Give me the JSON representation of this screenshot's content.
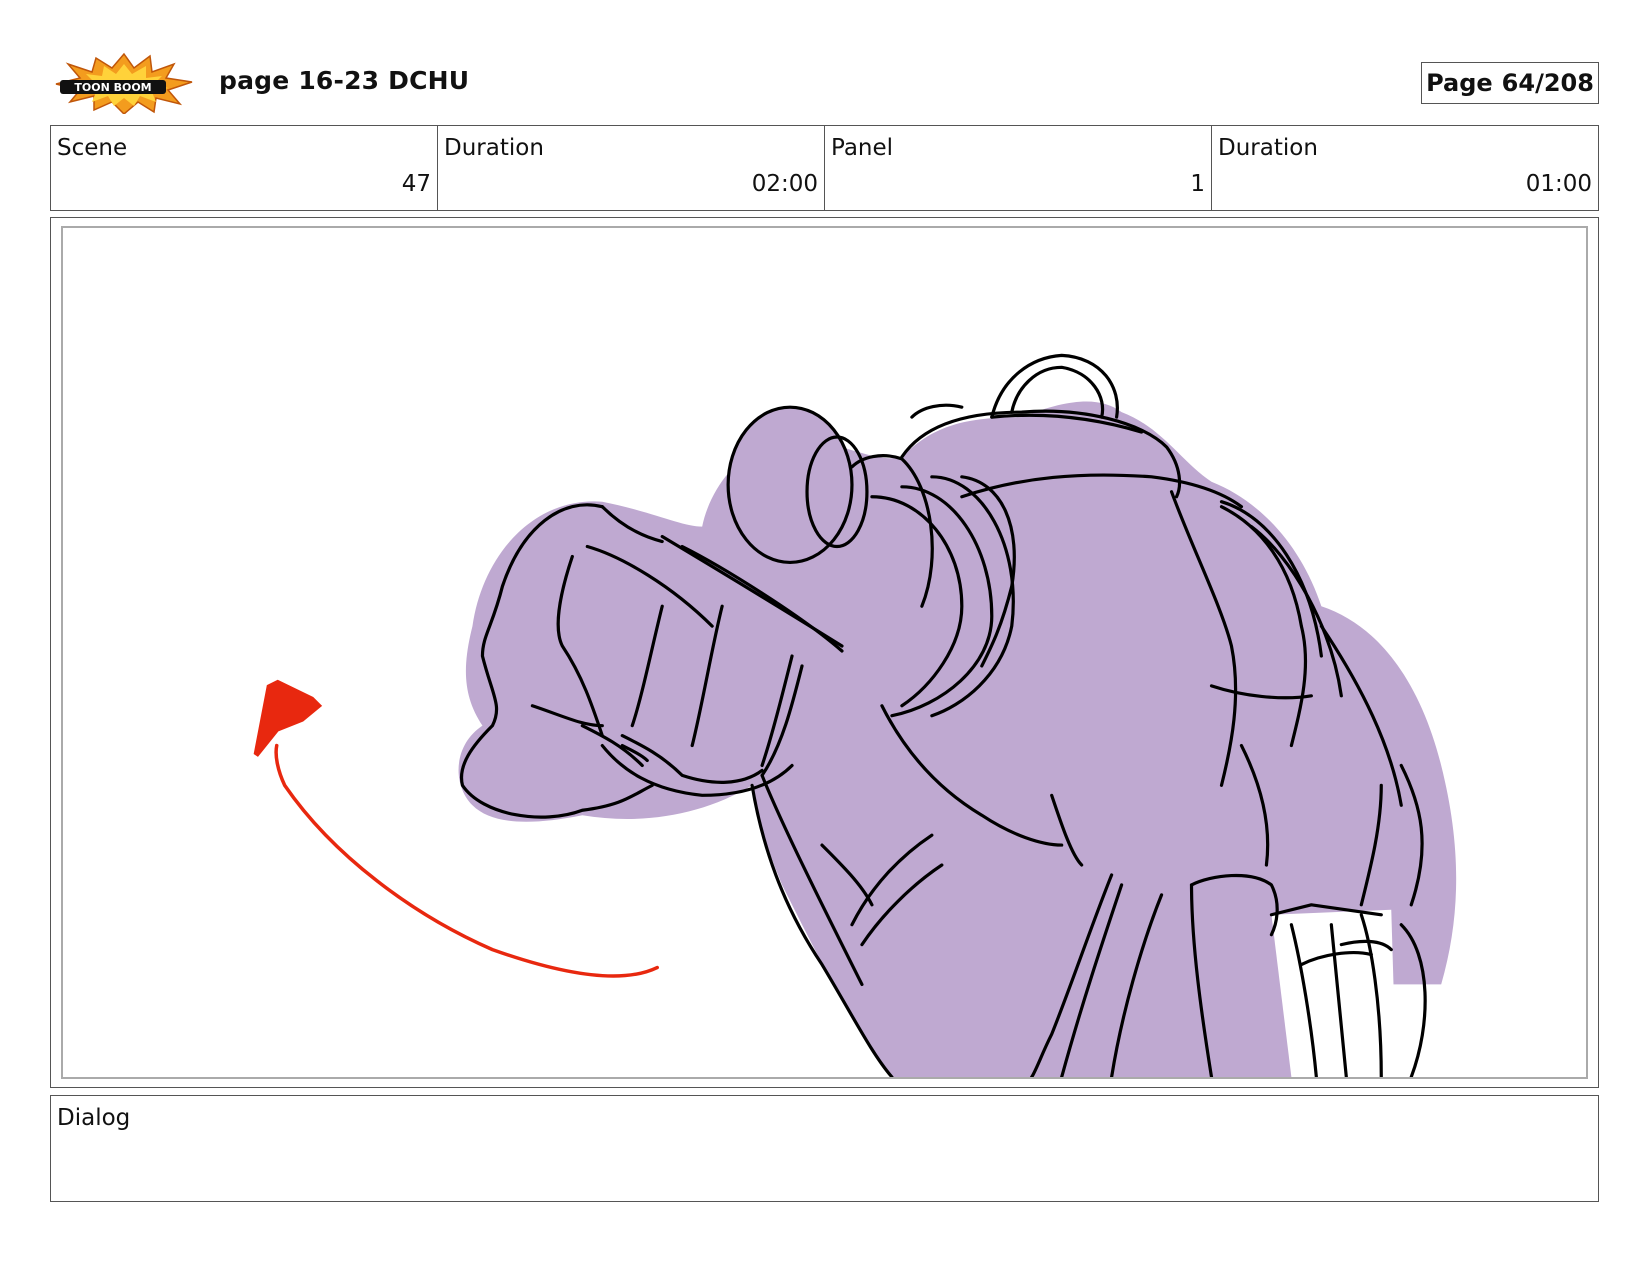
{
  "header": {
    "logo_name": "toon-boom-logo",
    "logo_text": "TOON BOOM",
    "title": "page 16-23 DCHU",
    "page_label": "Page",
    "page_value": "64/208"
  },
  "info": {
    "scene_label": "Scene",
    "scene_value": "47",
    "scene_duration_label": "Duration",
    "scene_duration_value": "02:00",
    "panel_label": "Panel",
    "panel_value": "1",
    "panel_duration_label": "Duration",
    "panel_duration_value": "01:00"
  },
  "panel": {
    "fill_color": "#bfa9d1",
    "line_color": "#000000",
    "arrow_color": "#e8280f"
  },
  "dialog": {
    "label": "Dialog"
  }
}
